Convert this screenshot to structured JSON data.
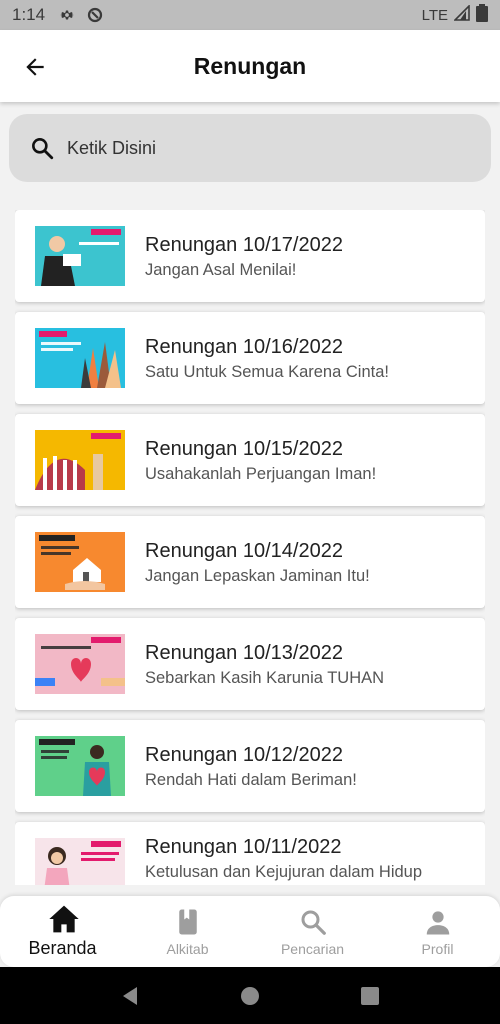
{
  "status_bar": {
    "time": "1:14",
    "network": "LTE"
  },
  "app_bar": {
    "title": "Renungan"
  },
  "search": {
    "placeholder": "Ketik Disini"
  },
  "items": [
    {
      "title": "Renungan 10/17/2022",
      "subtitle": "Jangan Asal Menilai!",
      "thumb_color": "#3cc4cf"
    },
    {
      "title": "Renungan 10/16/2022",
      "subtitle": "Satu Untuk Semua Karena Cinta!",
      "thumb_color": "#28bfe0"
    },
    {
      "title": "Renungan 10/15/2022",
      "subtitle": "Usahakanlah Perjuangan Iman!",
      "thumb_color": "#f5b800"
    },
    {
      "title": "Renungan 10/14/2022",
      "subtitle": "Jangan Lepaskan Jaminan Itu!",
      "thumb_color": "#f7892f"
    },
    {
      "title": "Renungan 10/13/2022",
      "subtitle": "Sebarkan Kasih Karunia TUHAN",
      "thumb_color": "#f2b8c6"
    },
    {
      "title": "Renungan 10/12/2022",
      "subtitle": "Rendah Hati dalam Beriman!",
      "thumb_color": "#5fd08a"
    },
    {
      "title": "Renungan 10/11/2022",
      "subtitle": "Ketulusan dan Kejujuran dalam Hidup Beriman",
      "thumb_color": "#f7e4ea"
    }
  ],
  "bottom_nav": {
    "beranda": "Beranda",
    "alkitab": "Alkitab",
    "pencarian": "Pencarian",
    "profil": "Profil"
  }
}
